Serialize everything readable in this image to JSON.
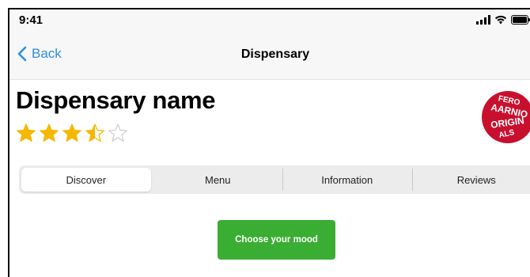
{
  "status": {
    "time": "9:41",
    "icons": [
      "cellular-signal-icon",
      "wifi-icon",
      "battery-icon"
    ]
  },
  "nav": {
    "back_label": "Back",
    "title": "Dispensary"
  },
  "dispensary": {
    "name": "Dispensary name",
    "rating": 3.5,
    "rating_max": 5,
    "logo_lines": [
      "FERO",
      "AARNIO",
      "ORIGIN",
      "ALS"
    ]
  },
  "tabs": [
    {
      "label": "Discover",
      "active": true
    },
    {
      "label": "Menu",
      "active": false
    },
    {
      "label": "Information",
      "active": false
    },
    {
      "label": "Reviews",
      "active": false
    }
  ],
  "mood_button_label": "Choose your mood",
  "colors": {
    "accent_blue": "#2f8ee0",
    "star_gold": "#f5b800",
    "mood_green": "#3aad33",
    "logo_red": "#c8102e"
  }
}
